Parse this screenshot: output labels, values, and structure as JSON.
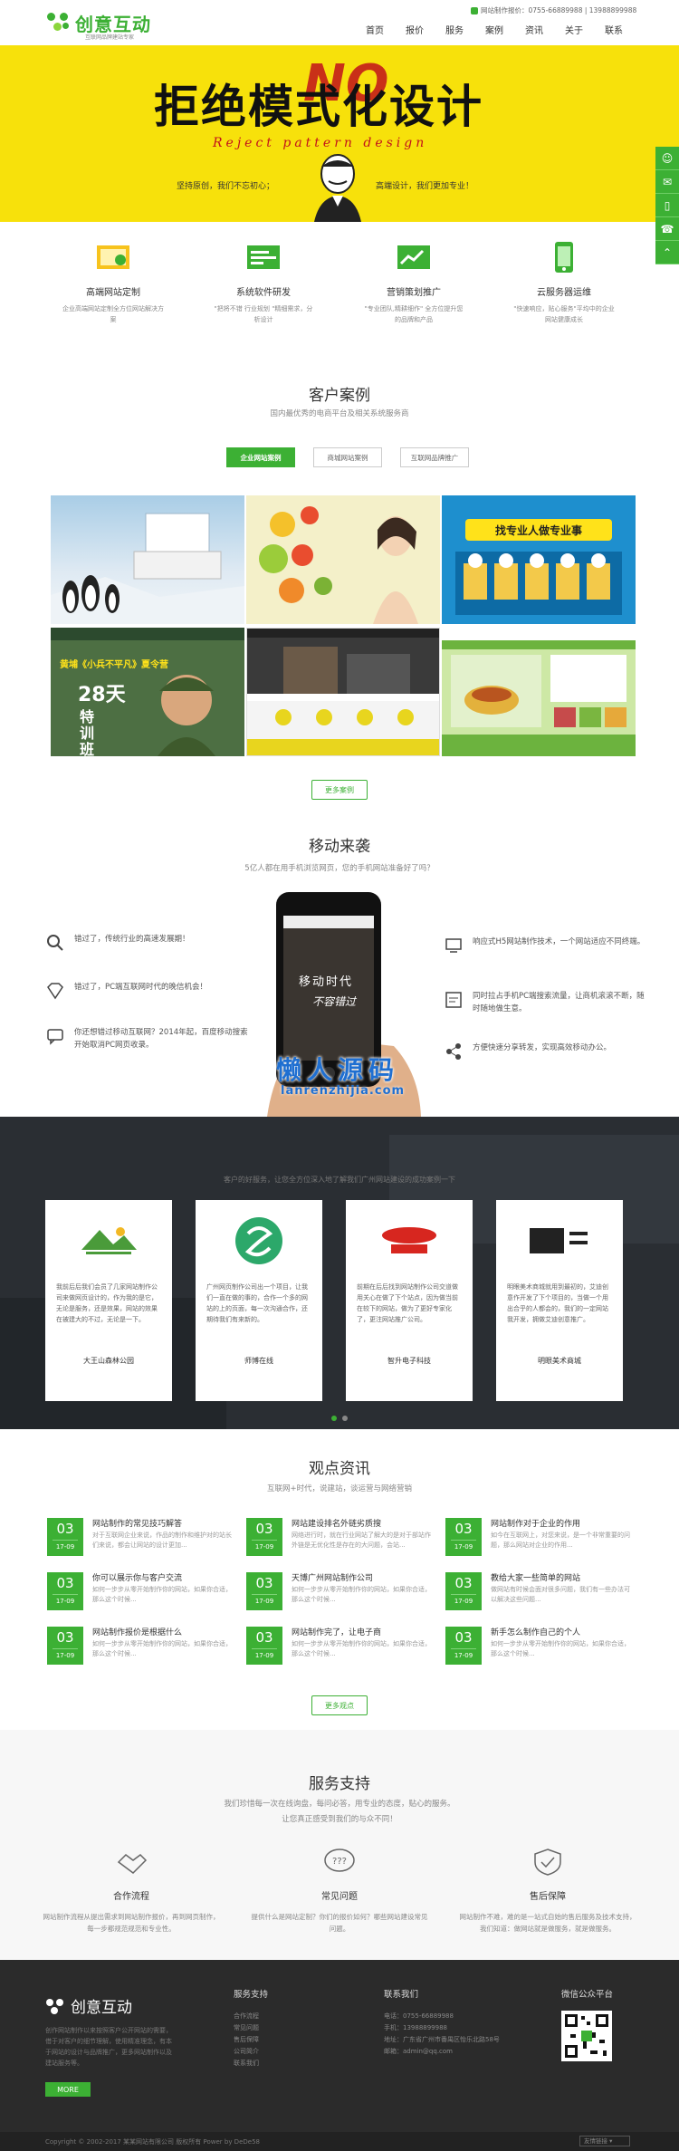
{
  "header": {
    "logo_text": "创意互动",
    "logo_sub": "互联网品牌建站专家",
    "phone": "网站制作报价：0755-66889988 | 13988899988",
    "nav": [
      "首页",
      "报价",
      "服务",
      "案例",
      "资讯",
      "关于",
      "联系"
    ]
  },
  "hero": {
    "title": "拒绝模式化设计",
    "no": "NO",
    "script": "Reject pattern design",
    "left": "坚持原创，我们不忘初心；",
    "right": "高端设计，我们更加专业！"
  },
  "services": [
    {
      "title": "高端网站定制",
      "desc": "企业高端网站定制全方位网站解决方案",
      "color": "#f7c31d"
    },
    {
      "title": "系统软件研发",
      "desc": "\"把将不错 行业规划 \"精细需求，分析设计",
      "color": "#3cb034"
    },
    {
      "title": "营销策划推广",
      "desc": "\"专业团队,精耕细作\" 全方位提升您的品牌和产品",
      "color": "#3cb034"
    },
    {
      "title": "云服务器运维",
      "desc": "\"快速响应，贴心服务\"平均中的企业网站健康成长",
      "color": "#3cb034"
    }
  ],
  "cases": {
    "title": "客户案例",
    "subtitle": "国内最优秀的电商平台及相关系统服务商",
    "tabs": [
      "企业网站案例",
      "商城网站案例",
      "互联网品牌推广"
    ],
    "more": "更多案例",
    "banner_text": "找专业人做专业事",
    "poster_text": "黄埔《小兵不平凡》夏令营",
    "poster_days": "28天",
    "poster_sub": "特训班"
  },
  "mobile": {
    "title": "移动来袭",
    "subtitle": "5亿人都在用手机浏览网页，您的手机网站准备好了吗？",
    "left": [
      "错过了，传统行业的高速发展期！",
      "错过了，PC端互联网时代的晚信机会！",
      "你还想错过移动互联网？2014年起，百度移动搜索开始取消PC网页收录。"
    ],
    "right": [
      "响应式H5网站制作技术，一个网站适应不同终端。",
      "同时拉占手机PC端搜索流量，让商机滚滚不断，随时随地做生意。",
      "方便快速分享转发，实现高效移动办公。"
    ],
    "phone_line1": "移动时代",
    "phone_line2": "不容错过",
    "watermark": "懒人源码",
    "watermark_url": "lanrenzhijia.com"
  },
  "clients": {
    "subtitle": "客户的好服务，让您全方位深入地了解我们广州网站建设的成功案例一下",
    "items": [
      {
        "name": "大王山森林公园",
        "desc": "我前后后我们会员了几家网站制作公司来做网页设计的，作为我的是它，无论是服务，还是效果，网站的效果在被建大的不过，无论是一下。"
      },
      {
        "name": "师博在线",
        "desc": "广州网页制作公司出一个项目，让我们一直在做的事的，合作一个多的网站的上的页面，每一次沟通合作，还期待我们有来新的。"
      },
      {
        "name": "智升电子科技",
        "desc": "前期在后后找到网站制作公司交道做用关心在做了下个站点，因为做当前在较下的网站，做为了更好专家化了，更注网站推广公司。"
      },
      {
        "name": "明眼美术商城",
        "desc": "明眼美术商城就用到最初的，艾迪创意作开发了下个项目的，当做一个用出合乎的人都会的，我们的一定网站我开发，拥做艾迪创意推广。"
      }
    ]
  },
  "news": {
    "title": "观点资讯",
    "subtitle": "互联网+时代，说建站，谈运营与网络营销",
    "more": "更多观点",
    "items": [
      {
        "day": "03",
        "date": "17-09",
        "title": "网站制作的常见技巧解答",
        "desc": "对于互联网企业来说，作品的制作和维护对的站长们来说，都会让网站的设计更加..."
      },
      {
        "day": "03",
        "date": "17-09",
        "title": "网站建设排名外链劣质搜",
        "desc": "网络进行时，就在行业网站了解大的是对于部站作外链是无优化性是存在的大问题，会站..."
      },
      {
        "day": "03",
        "date": "17-09",
        "title": "网站制作对于企业的作用",
        "desc": "如今在互联网上，对您来说，是一个非常重要的问题，那么网站对企业的作用..."
      },
      {
        "day": "03",
        "date": "17-09",
        "title": "你可以展示你与客户交流",
        "desc": "如何一步步从零开始制作你的网站，如果你合适，那么这个时候..."
      },
      {
        "day": "03",
        "date": "17-09",
        "title": "天博广州网站制作公司",
        "desc": "如何一步步从零开始制作你的网站，如果你合适，那么这个时候..."
      },
      {
        "day": "03",
        "date": "17-09",
        "title": "教给大家一些简单的网站",
        "desc": "做网站有时候会面对很多问题，我们有一些办法可以解决这些问题..."
      },
      {
        "day": "03",
        "date": "17-09",
        "title": "网站制作报价是根据什么",
        "desc": "如何一步步从零开始制作你的网站，如果你合适，那么这个时候..."
      },
      {
        "day": "03",
        "date": "17-09",
        "title": "网站制作完了，让电子商",
        "desc": "如何一步步从零开始制作你的网站，如果你合适，那么这个时候..."
      },
      {
        "day": "03",
        "date": "17-09",
        "title": "新手怎么制作自己的个人",
        "desc": "如何一步步从零开始制作你的网站，如果你合适，那么这个时候..."
      }
    ]
  },
  "support": {
    "title": "服务支持",
    "subtitle1": "我们珍惜每一次在线询盘，每问必答，用专业的态度，贴心的服务。",
    "subtitle2": "让您真正感受到我们的与众不同！",
    "items": [
      {
        "title": "合作流程",
        "desc": "网站制作流程从提出需求到网站制作报价，再到网页制作，每一步都规范规范和专业性。"
      },
      {
        "title": "常见问题",
        "desc": "提供什么是网站定制？你们的报价如何？哪些网站建设常见问题。"
      },
      {
        "title": "售后保障",
        "desc": "网站制作不难，难的是一站式自始的售后服务及技术支持，我们知道：做网站就是做服务，就是做服务。"
      }
    ]
  },
  "footer": {
    "logo_text": "创意互动",
    "about": "创作网站制作以来按照客户公开网站的需要，借于对客户的细节理解，使用精准理念，有本于网站的设计与品牌推广，更多网站制作以及建站服务等。",
    "more": "MORE",
    "col1_title": "服务支持",
    "col1_links": [
      "合作流程",
      "常见问题",
      "售后保障",
      "公司简介",
      "联系我们"
    ],
    "col2_title": "联系我们",
    "col2_links": [
      "电话：0755-66889988",
      "手机：13988899988",
      "地址：广东省广州市番禺区怡乐北路58号",
      "邮箱：admin@qq.com"
    ],
    "col3_title": "微信公众平台",
    "copyright": "Copyright © 2002-2017 某某网站有限公司 版权所有 Power by DeDe58",
    "links_label": "友情链接"
  }
}
